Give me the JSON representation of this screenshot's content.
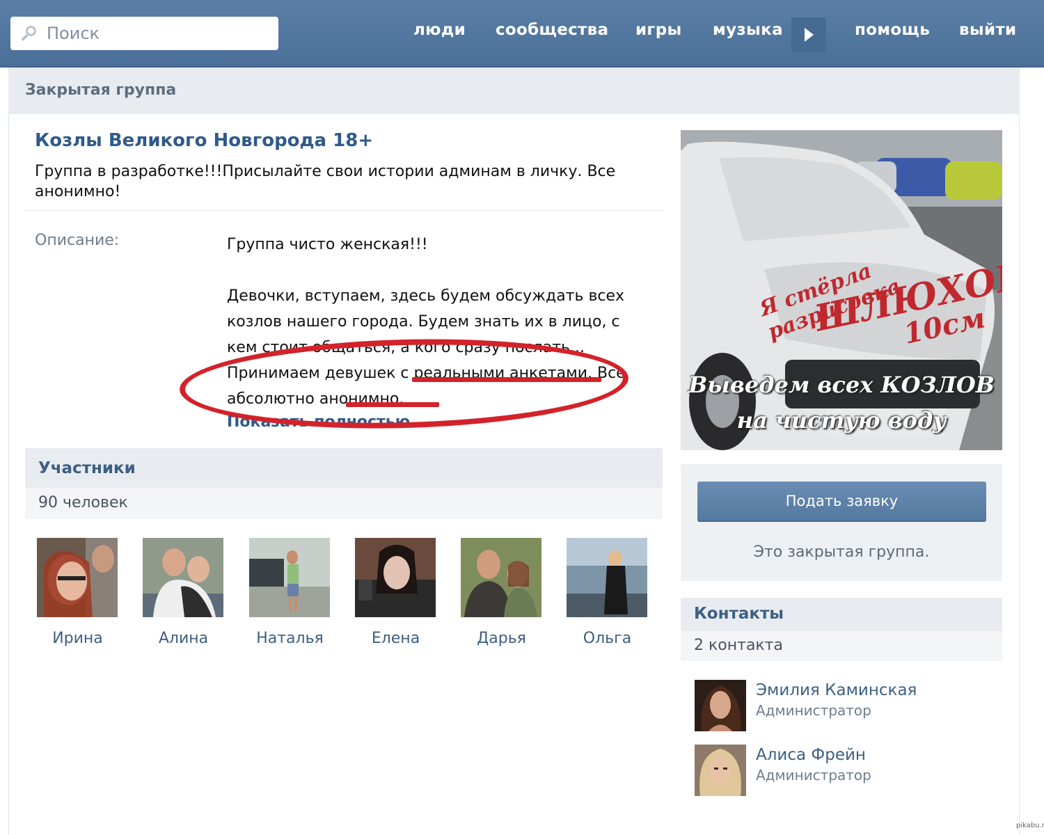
{
  "header": {
    "search_placeholder": "Поиск",
    "nav": [
      "люди",
      "сообщества",
      "игры",
      "музыка",
      "помощь",
      "выйти"
    ]
  },
  "page": {
    "closed_title": "Закрытая группа"
  },
  "group": {
    "name": "Козлы Великого Новгорода 18+",
    "status": "Группа в разработке!!!Присылайте свои истории админам в личку. Все анонимно!",
    "description_label": "Описание:",
    "description_p1": "Группа чисто женская!!!",
    "description_p2": "Девочки, вступаем, здесь будем обсуждать всех козлов нашего города. Будем знать их в лицо, с кем стоит общаться, а кого сразу послать... Принимаем девушек с реальными анкетами. Все абсолютно анонимно.",
    "show_more": "Показать полностью"
  },
  "members": {
    "title": "Участники",
    "count": "90 человек",
    "list": [
      {
        "name": "Ирина"
      },
      {
        "name": "Алина"
      },
      {
        "name": "Наталья"
      },
      {
        "name": "Елена"
      },
      {
        "name": "Дарья"
      },
      {
        "name": "Ольга"
      }
    ]
  },
  "cover": {
    "caption_line1": "Выведем всех КОЗЛОВ",
    "caption_line2": "на чистую воду"
  },
  "join": {
    "button": "Подать заявку",
    "note": "Это закрытая группа."
  },
  "contacts": {
    "title": "Контакты",
    "count": "2 контакта",
    "list": [
      {
        "name": "Эмилия Каминская",
        "role": "Администратор"
      },
      {
        "name": "Алиса Фрейн",
        "role": "Администратор"
      }
    ]
  },
  "colors": {
    "topbar": "#4a6f98",
    "link": "#2f5a8a",
    "annotation": "#d4222a"
  },
  "watermark": "pikabu.ru"
}
